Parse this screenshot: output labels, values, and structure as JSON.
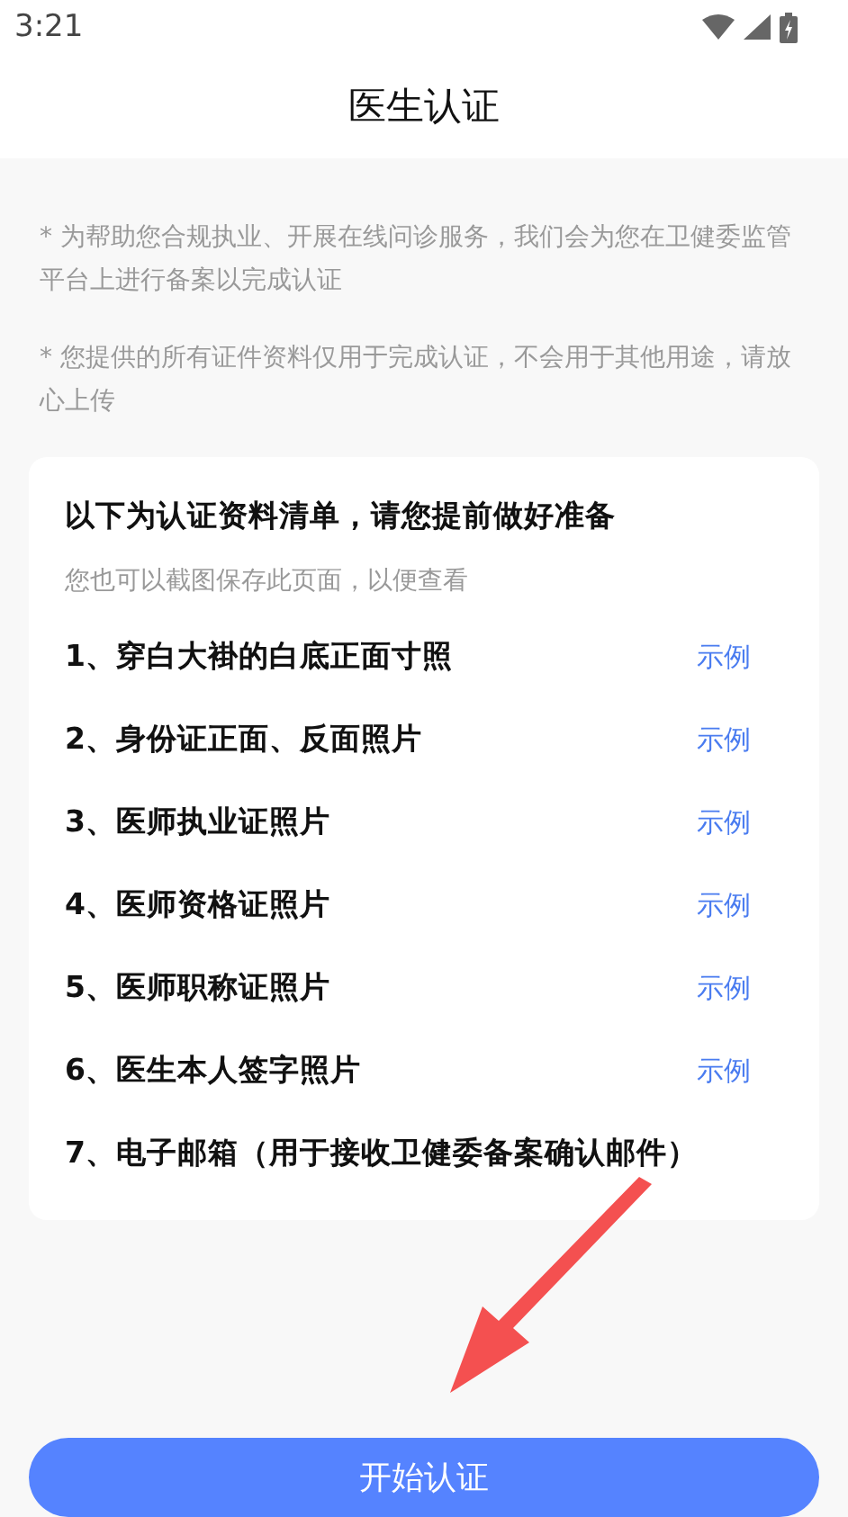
{
  "status_bar": {
    "time": "3:21"
  },
  "header": {
    "title": "医生认证"
  },
  "notes": [
    "* 为帮助您合规执业、开展在线问诊服务，我们会为您在卫健委监管平台上进行备案以完成认证",
    "* 您提供的所有证件资料仅用于完成认证，不会用于其他用途，请放心上传"
  ],
  "card": {
    "title": "以下为认证资料清单，请您提前做好准备",
    "subtitle": "您也可以截图保存此页面，以便查看",
    "items": [
      {
        "label": "1、穿白大褂的白底正面寸照",
        "example": "示例"
      },
      {
        "label": "2、身份证正面、反面照片",
        "example": "示例"
      },
      {
        "label": "3、医师执业证照片",
        "example": "示例"
      },
      {
        "label": "4、医师资格证照片",
        "example": "示例"
      },
      {
        "label": "5、医师职称证照片",
        "example": "示例"
      },
      {
        "label": "6、医生本人签字照片",
        "example": "示例"
      },
      {
        "label": "7、电子邮箱（用于接收卫健委备案确认邮件）"
      }
    ]
  },
  "button": {
    "label": "开始认证"
  }
}
